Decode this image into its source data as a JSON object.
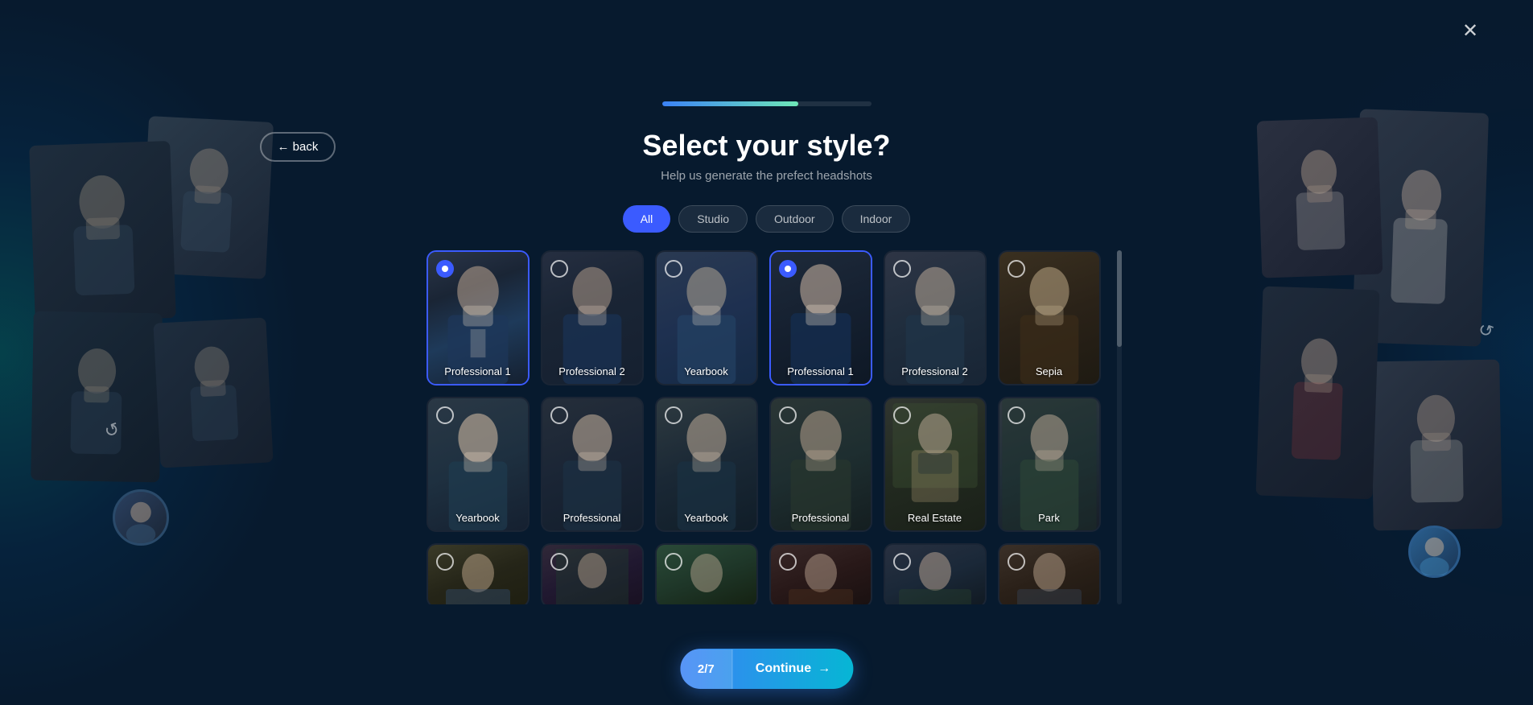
{
  "progress": {
    "fill_percent": "65%",
    "label": "Progress bar"
  },
  "header": {
    "back_label": "← back",
    "close_label": "✕",
    "title": "Select your style?",
    "subtitle": "Help us generate the prefect headshots"
  },
  "filters": {
    "tabs": [
      {
        "id": "all",
        "label": "All",
        "active": true
      },
      {
        "id": "studio",
        "label": "Studio",
        "active": false
      },
      {
        "id": "outdoor",
        "label": "Outdoor",
        "active": false
      },
      {
        "id": "indoor",
        "label": "Indoor",
        "active": false
      }
    ]
  },
  "styles": [
    {
      "id": 1,
      "label": "Professional 1",
      "portrait": "portrait-1",
      "selected": true,
      "radio": "checked"
    },
    {
      "id": 2,
      "label": "Professional 2",
      "portrait": "portrait-2",
      "selected": false,
      "radio": "unchecked"
    },
    {
      "id": 3,
      "label": "Yearbook",
      "portrait": "portrait-3",
      "selected": false,
      "radio": "unchecked"
    },
    {
      "id": 4,
      "label": "Professional 1",
      "portrait": "portrait-4",
      "selected": true,
      "radio": "checked-teal"
    },
    {
      "id": 5,
      "label": "Professional 2",
      "portrait": "portrait-5",
      "selected": false,
      "radio": "unchecked"
    },
    {
      "id": 6,
      "label": "Sepia",
      "portrait": "portrait-6",
      "selected": false,
      "radio": "unchecked"
    },
    {
      "id": 7,
      "label": "Yearbook",
      "portrait": "portrait-7",
      "selected": false,
      "radio": "unchecked"
    },
    {
      "id": 8,
      "label": "Professional",
      "portrait": "portrait-8",
      "selected": false,
      "radio": "unchecked"
    },
    {
      "id": 9,
      "label": "Yearbook",
      "portrait": "portrait-9",
      "selected": false,
      "radio": "unchecked"
    },
    {
      "id": 10,
      "label": "Professional",
      "portrait": "portrait-10",
      "selected": false,
      "radio": "unchecked"
    },
    {
      "id": 11,
      "label": "Real Estate",
      "portrait": "portrait-11",
      "selected": false,
      "radio": "unchecked"
    },
    {
      "id": 12,
      "label": "Park",
      "portrait": "portrait-12",
      "selected": false,
      "radio": "unchecked"
    },
    {
      "id": 13,
      "label": "",
      "portrait": "portrait-13",
      "selected": false,
      "radio": "unchecked"
    },
    {
      "id": 14,
      "label": "",
      "portrait": "portrait-14",
      "selected": false,
      "radio": "unchecked"
    },
    {
      "id": 15,
      "label": "",
      "portrait": "portrait-15",
      "selected": false,
      "radio": "unchecked"
    },
    {
      "id": 16,
      "label": "",
      "portrait": "portrait-16",
      "selected": false,
      "radio": "unchecked"
    },
    {
      "id": 17,
      "label": "",
      "portrait": "portrait-17",
      "selected": false,
      "radio": "unchecked"
    },
    {
      "id": 18,
      "label": "",
      "portrait": "portrait-18",
      "selected": false,
      "radio": "unchecked"
    }
  ],
  "continue_bar": {
    "badge": "2/7",
    "button_label": "Continue",
    "arrow": "→"
  }
}
